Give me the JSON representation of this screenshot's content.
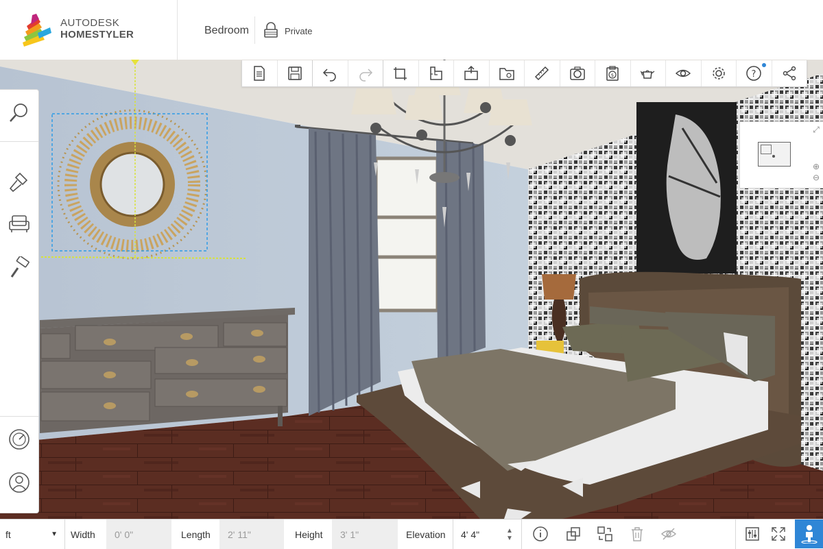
{
  "header": {
    "brand_top": "AUTODESK",
    "brand_bottom": "HOMESTYLER",
    "project_name": "Bedroom",
    "privacy": "Private"
  },
  "toolbar": {
    "items": [
      "new-document",
      "save",
      "undo",
      "redo",
      "draw-room",
      "floorplan",
      "add-floor",
      "open-folder",
      "measure",
      "snapshot",
      "cost",
      "render",
      "view-toggle",
      "settings",
      "help",
      "share"
    ]
  },
  "left_panel": {
    "items": [
      "search",
      "paint",
      "furniture",
      "roller",
      "compass",
      "user"
    ]
  },
  "bottom_bar": {
    "unit": "ft",
    "width_label": "Width",
    "width_value": "0' 0\"",
    "length_label": "Length",
    "length_value": "2' 11\"",
    "height_label": "Height",
    "height_value": "3' 1\"",
    "elevation_label": "Elevation",
    "elevation_value": "4' 4\""
  },
  "colors": {
    "accent": "#2f86d6",
    "wall": "#b9c7d6",
    "floor": "#5a2c22",
    "selection": "#2e9be6"
  }
}
